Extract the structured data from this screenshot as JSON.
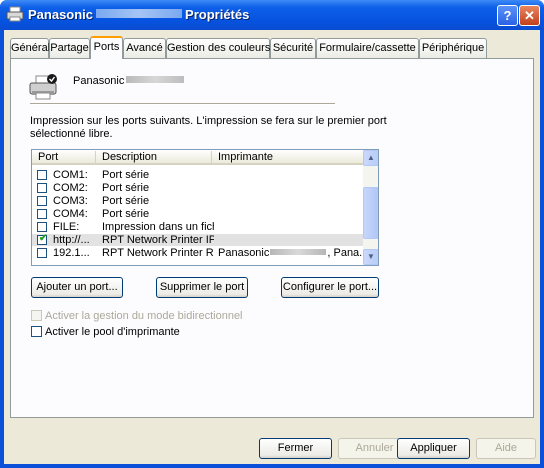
{
  "window": {
    "title_prefix": "Panasonic",
    "title_suffix": "Propriétés",
    "help_label": "?",
    "close_label": "✕"
  },
  "tabs": [
    {
      "label": "Général"
    },
    {
      "label": "Partage"
    },
    {
      "label": "Ports"
    },
    {
      "label": "Avancé"
    },
    {
      "label": "Gestion des couleurs"
    },
    {
      "label": "Sécurité"
    },
    {
      "label": "Formulaire/cassette"
    },
    {
      "label": "Périphérique"
    }
  ],
  "printer": {
    "name": "Panasonic",
    "icon": "printer-icon"
  },
  "description": "Impression sur les ports suivants. L'impression se fera sur le premier port sélectionné libre.",
  "ports_table": {
    "columns": [
      "Port",
      "Description",
      "Imprimante"
    ],
    "rows": [
      {
        "checked": false,
        "port": "COM1:",
        "description": "Port série",
        "printer": ""
      },
      {
        "checked": false,
        "port": "COM2:",
        "description": "Port série",
        "printer": ""
      },
      {
        "checked": false,
        "port": "COM3:",
        "description": "Port série",
        "printer": ""
      },
      {
        "checked": false,
        "port": "COM4:",
        "description": "Port série",
        "printer": ""
      },
      {
        "checked": false,
        "port": "FILE:",
        "description": "Impression dans un fich...",
        "printer": ""
      },
      {
        "checked": true,
        "port": "http://...",
        "description": "RPT Network Printer IP...",
        "printer": ""
      },
      {
        "checked": false,
        "port": "192.1...",
        "description": "RPT Network Printer R...",
        "printer": "Panasonic",
        "printer_suffix": ", Pana..."
      }
    ]
  },
  "port_buttons": {
    "add": "Ajouter un port...",
    "delete": "Supprimer le port",
    "configure": "Configurer le port..."
  },
  "options": {
    "bidirectional": {
      "label": "Activer la gestion du mode bidirectionnel",
      "checked": false,
      "enabled": false
    },
    "pool": {
      "label": "Activer le pool d'imprimante",
      "checked": false,
      "enabled": true
    }
  },
  "footer_buttons": {
    "close": "Fermer",
    "cancel": "Annuler",
    "apply": "Appliquer",
    "help": "Aide"
  }
}
